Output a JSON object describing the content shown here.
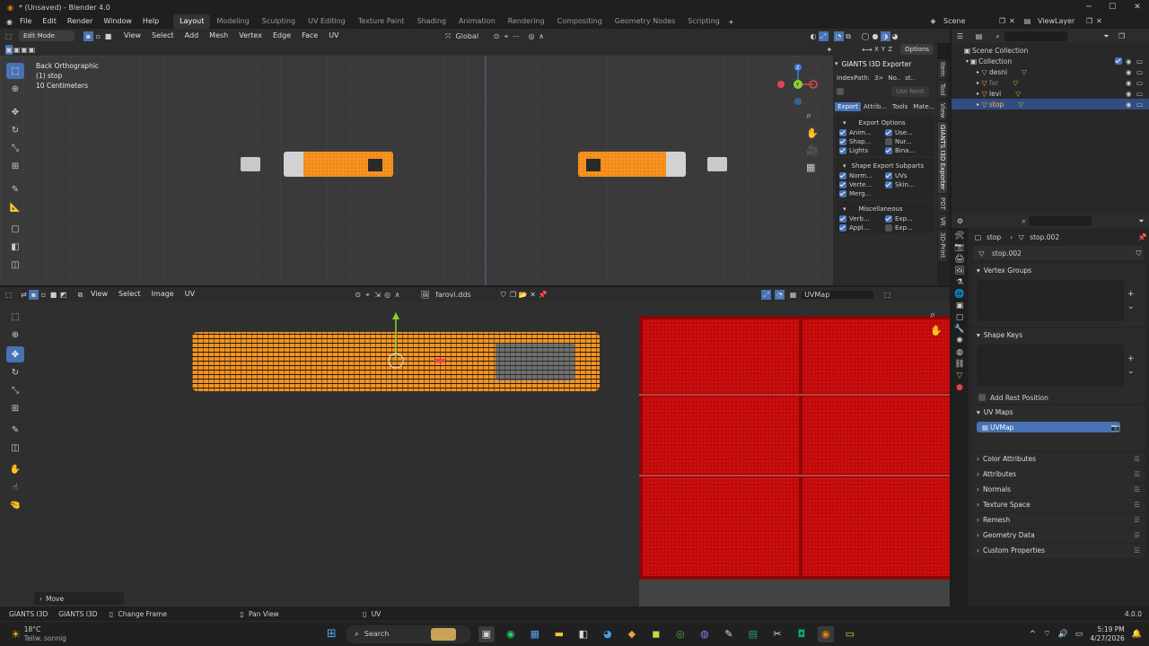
{
  "app": {
    "title": "* (Unsaved) - Blender 4.0",
    "version": "4.0.0"
  },
  "menu": [
    "File",
    "Edit",
    "Render",
    "Window",
    "Help"
  ],
  "workspaces": [
    "Layout",
    "Modeling",
    "Sculpting",
    "UV Editing",
    "Texture Paint",
    "Shading",
    "Animation",
    "Rendering",
    "Compositing",
    "Geometry Nodes",
    "Scripting"
  ],
  "scene": {
    "name": "Scene",
    "view_layer": "ViewLayer"
  },
  "viewport": {
    "mode": "Edit Mode",
    "menu": [
      "View",
      "Select",
      "Add",
      "Mesh",
      "Vertex",
      "Edge",
      "Face",
      "UV"
    ],
    "orientation": "Global",
    "options": "Options",
    "info": [
      "Back Orthographic",
      "(1) stop",
      "10 Centimeters"
    ]
  },
  "npanel": {
    "title": "GIANTS I3D Exporter",
    "index_path_label": "IndexPath:",
    "index_path_vals": [
      "3>",
      "No..",
      "st.."
    ],
    "use_next": "Use Next",
    "tabs": [
      "Export",
      "Attrib...",
      "Tools",
      "Mate..."
    ],
    "export_options": {
      "title": "Export Options",
      "items": [
        {
          "label": "Anim...",
          "on": true
        },
        {
          "label": "Use...",
          "on": true
        },
        {
          "label": "Shap...",
          "on": true
        },
        {
          "label": "Nur...",
          "on": false
        },
        {
          "label": "Lights",
          "on": true
        },
        {
          "label": "Bina...",
          "on": true
        }
      ]
    },
    "shape_export": {
      "title": "Shape Export Subparts",
      "items": [
        {
          "label": "Norm...",
          "on": true
        },
        {
          "label": "UVs",
          "on": true
        },
        {
          "label": "Verte...",
          "on": true
        },
        {
          "label": "Skin...",
          "on": true
        },
        {
          "label": "Merg...",
          "on": true
        }
      ]
    },
    "misc": {
      "title": "Miscellaneous",
      "items": [
        {
          "label": "Verb...",
          "on": true
        },
        {
          "label": "Exp...",
          "on": true
        },
        {
          "label": "Appl...",
          "on": true
        },
        {
          "label": "Exp...",
          "on": false
        }
      ]
    },
    "side_tabs": [
      "Item",
      "Tool",
      "View",
      "GIANTS I3D Exporter",
      "PDT",
      "VR",
      "3D-Print"
    ]
  },
  "outliner": {
    "root": "Scene Collection",
    "collection": "Collection",
    "items": [
      {
        "name": "desni",
        "active": false
      },
      {
        "name": "far",
        "active": false
      },
      {
        "name": "levi",
        "active": false
      },
      {
        "name": "stop",
        "active": true
      }
    ]
  },
  "uv_editor": {
    "menu": [
      "View",
      "Select",
      "Image",
      "UV"
    ],
    "image": "farovi.dds",
    "uvmap": "UVMap"
  },
  "properties": {
    "breadcrumb": [
      "stop",
      "stop.002"
    ],
    "mesh_name": "stop.002",
    "sections": {
      "vertex_groups": "Vertex Groups",
      "shape_keys": "Shape Keys",
      "add_rest": "Add Rest Position",
      "uv_maps": "UV Maps",
      "uv_map_item": "UVMap"
    },
    "collapsed": [
      "Color Attributes",
      "Attributes",
      "Normals",
      "Texture Space",
      "Remesh",
      "Geometry Data",
      "Custom Properties"
    ]
  },
  "last_op": "Move",
  "statusbar": {
    "left": [
      "GIANTS I3D",
      "GIANTS I3D"
    ],
    "items": [
      "Change Frame",
      "Pan View",
      "UV"
    ]
  },
  "taskbar": {
    "weather_temp": "18°C",
    "weather_desc": "Teilw. sonnig",
    "search": "Search",
    "time": "5:19 PM",
    "date": "4/27/2026"
  },
  "colors": {
    "accent": "#4772b3",
    "mesh_orange": "#f7931e",
    "texture_red": "#c00a0a",
    "x_axis": "#e8414f",
    "y_axis": "#8ad22d",
    "z_axis": "#3b7dd8"
  }
}
